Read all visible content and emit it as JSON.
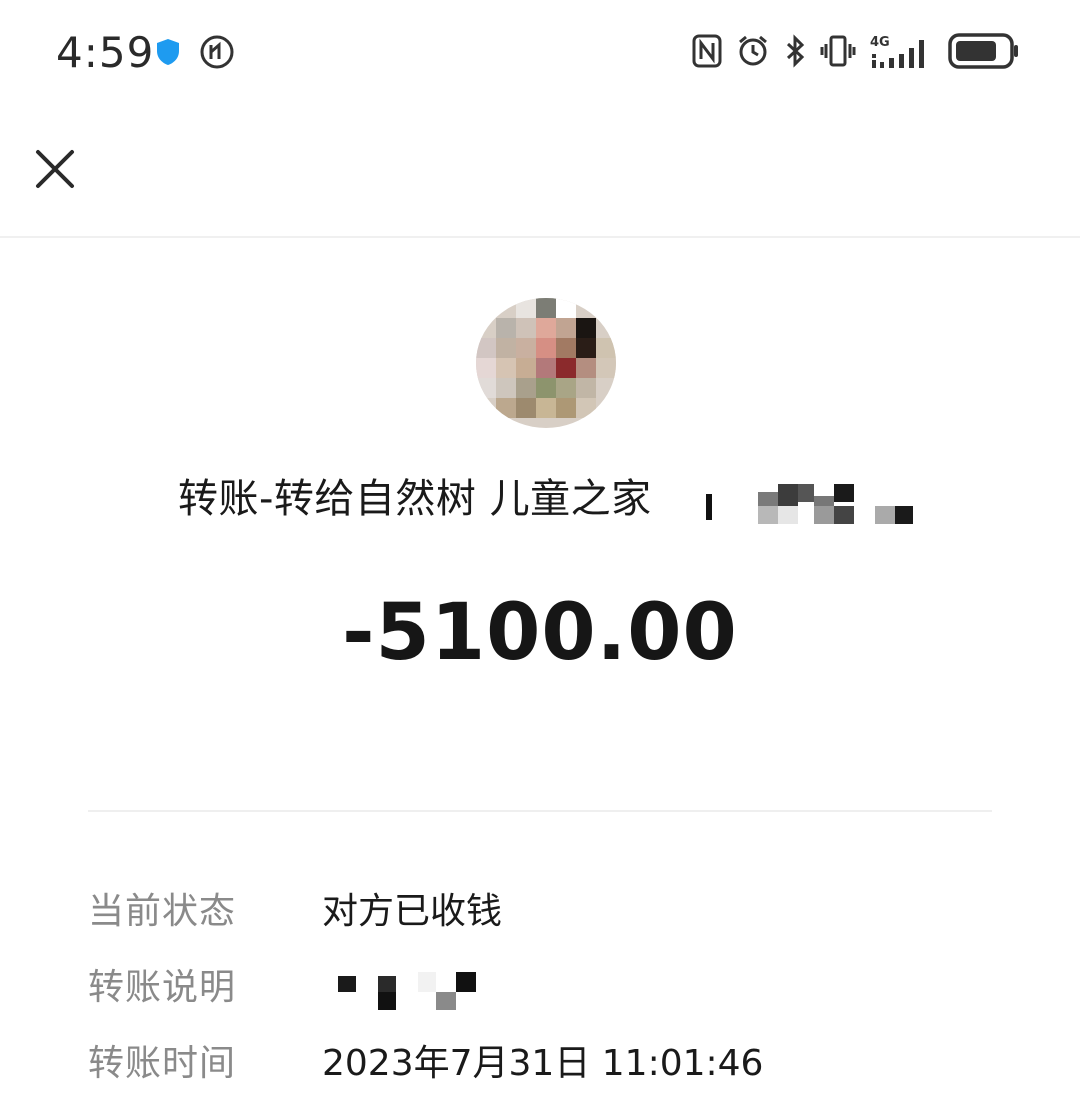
{
  "status_bar": {
    "time": "4:59",
    "network": "4G",
    "icons": [
      "shield-icon",
      "hd-call-icon",
      "nfc-icon",
      "alarm-icon",
      "bluetooth-icon",
      "vibrate-icon",
      "signal-icon",
      "battery-icon"
    ]
  },
  "nav": {
    "close_icon": "close-icon"
  },
  "transfer": {
    "title": "转账-转给自然树 儿童之家",
    "amount": "-5100.00"
  },
  "details": [
    {
      "label": "当前状态",
      "value": "对方已收钱"
    },
    {
      "label": "转账说明",
      "value": ""
    },
    {
      "label": "转账时间",
      "value": "2023年7月31日 11:01:46"
    }
  ],
  "colors": {
    "background": "#ffffff",
    "primary_text": "#1a1a1a",
    "secondary_text": "#8a8a8a",
    "divider": "#efefef",
    "shield_accent": "#1e9bf0"
  }
}
